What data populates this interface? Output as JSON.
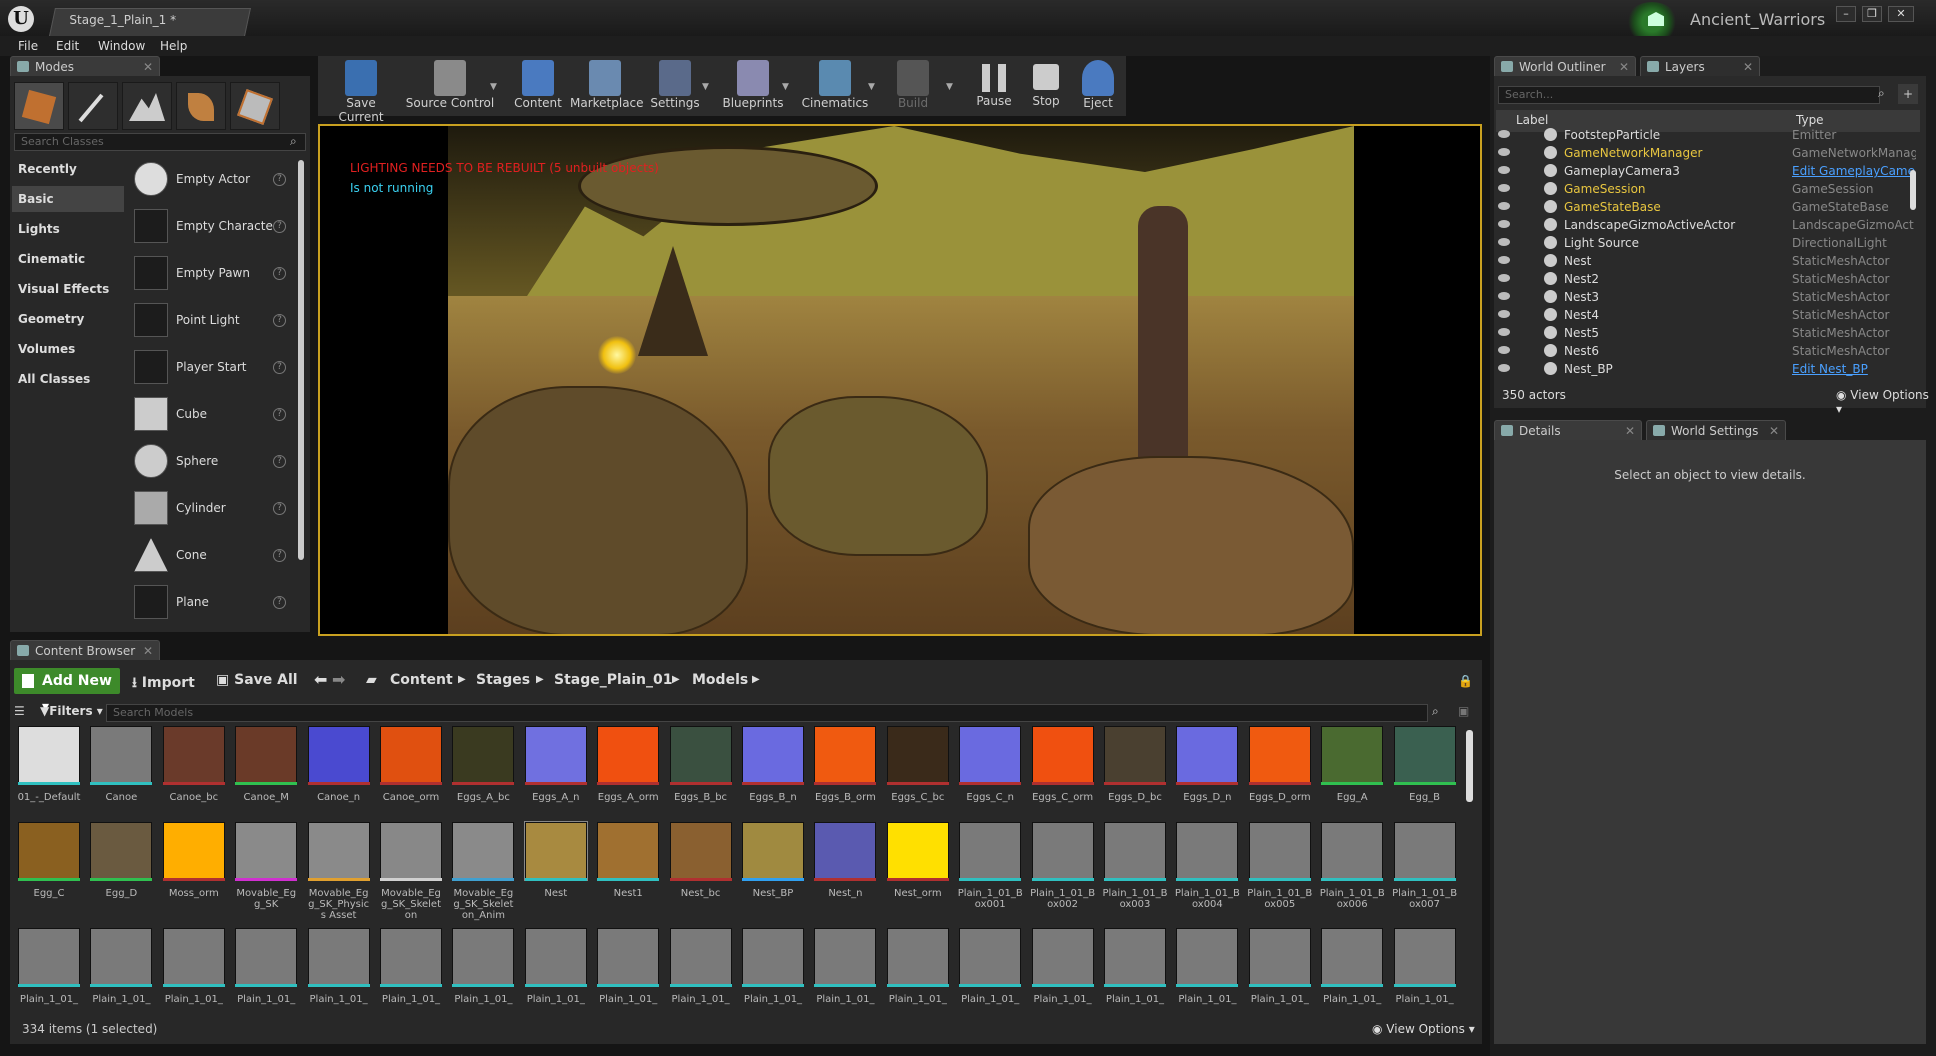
{
  "window": {
    "doc_tab": "Stage_1_Plain_1",
    "doc_tab_dirty": "*",
    "project": "Ancient_Warriors"
  },
  "menu": [
    "File",
    "Edit",
    "Window",
    "Help"
  ],
  "modes": {
    "tab": "Modes",
    "search_placeholder": "Search Classes",
    "categories": [
      "Recently Placed",
      "Basic",
      "Lights",
      "Cinematic",
      "Visual Effects",
      "Geometry",
      "Volumes",
      "All Classes"
    ],
    "selected_category": "Basic",
    "items": [
      "Empty Actor",
      "Empty Characte",
      "Empty Pawn",
      "Point Light",
      "Player Start",
      "Cube",
      "Sphere",
      "Cylinder",
      "Cone",
      "Plane"
    ]
  },
  "toolbar": [
    "Save Current",
    "Source Control",
    "Content",
    "Marketplace",
    "Settings",
    "Blueprints",
    "Cinematics",
    "Build",
    "Pause",
    "Stop",
    "Eject"
  ],
  "viewport": {
    "warning": "LIGHTING NEEDS TO BE REBUILT (5 unbuilt objects)",
    "status": "Is not running"
  },
  "outliner": {
    "tabs": [
      "World Outliner",
      "Layers"
    ],
    "search_placeholder": "Search...",
    "col_label": "Label",
    "col_type": "Type",
    "rows": [
      {
        "label": "FootstepParticle",
        "type": "Emitter",
        "link": false
      },
      {
        "label": "GameNetworkManager",
        "type": "GameNetworkManag",
        "link": false,
        "hl": true
      },
      {
        "label": "GameplayCamera3",
        "type": "Edit GameplayCame",
        "link": true
      },
      {
        "label": "GameSession",
        "type": "GameSession",
        "link": false,
        "hl": true
      },
      {
        "label": "GameStateBase",
        "type": "GameStateBase",
        "link": false,
        "hl": true
      },
      {
        "label": "LandscapeGizmoActiveActor",
        "type": "LandscapeGizmoAct",
        "link": false
      },
      {
        "label": "Light Source",
        "type": "DirectionalLight",
        "link": false
      },
      {
        "label": "Nest",
        "type": "StaticMeshActor",
        "link": false
      },
      {
        "label": "Nest2",
        "type": "StaticMeshActor",
        "link": false
      },
      {
        "label": "Nest3",
        "type": "StaticMeshActor",
        "link": false
      },
      {
        "label": "Nest4",
        "type": "StaticMeshActor",
        "link": false
      },
      {
        "label": "Nest5",
        "type": "StaticMeshActor",
        "link": false
      },
      {
        "label": "Nest6",
        "type": "StaticMeshActor",
        "link": false
      },
      {
        "label": "Nest_BP",
        "type": "Edit Nest_BP",
        "link": true
      }
    ],
    "count": "350 actors",
    "view_options": "View Options"
  },
  "details": {
    "tabs": [
      "Details",
      "World Settings"
    ],
    "empty": "Select an object to view details."
  },
  "content_browser": {
    "tab": "Content Browser",
    "add_new": "Add New",
    "import": "Import",
    "save_all": "Save All",
    "path": [
      "Content",
      "Stages",
      "Stage_Plain_01",
      "Models"
    ],
    "filters": "Filters",
    "search_placeholder": "Search Models",
    "status": "334 items (1 selected)",
    "view_options": "View Options",
    "assets_row1": [
      "01_-_Default",
      "Canoe",
      "Canoe_bc",
      "Canoe_M",
      "Canoe_n",
      "Canoe_orm",
      "Eggs_A_bc",
      "Eggs_A_n",
      "Eggs_A_orm",
      "Eggs_B_bc",
      "Eggs_B_n",
      "Eggs_B_orm",
      "Eggs_C_bc",
      "Eggs_C_n",
      "Eggs_C_orm",
      "Eggs_D_bc",
      "Eggs_D_n",
      "Eggs_D_orm",
      "Egg_A",
      "Egg_B"
    ],
    "assets_row2": [
      "Egg_C",
      "Egg_D",
      "Moss_orm",
      "Movable_Egg_SK",
      "Movable_Egg_SK_Physics Asset",
      "Movable_Egg_SK_Skeleton",
      "Movable_Egg_SK_Skeleton_Anim",
      "Nest",
      "Nest1",
      "Nest_bc",
      "Nest_BP",
      "Nest_n",
      "Nest_orm",
      "Plain_1_01_Box001",
      "Plain_1_01_Box002",
      "Plain_1_01_Box003",
      "Plain_1_01_Box004",
      "Plain_1_01_Box005",
      "Plain_1_01_Box006",
      "Plain_1_01_Box007"
    ],
    "assets_row3": [
      "Plain_1_01_",
      "Plain_1_01_",
      "Plain_1_01_",
      "Plain_1_01_",
      "Plain_1_01_",
      "Plain_1_01_",
      "Plain_1_01_",
      "Plain_1_01_",
      "Plain_1_01_",
      "Plain_1_01_",
      "Plain_1_01_",
      "Plain_1_01_",
      "Plain_1_01_",
      "Plain_1_01_",
      "Plain_1_01_",
      "Plain_1_01_",
      "Plain_1_01_",
      "Plain_1_01_",
      "Plain_1_01_",
      "Plain_1_01_"
    ],
    "selected_asset": "Nest"
  },
  "colors": {
    "accent_green": "#3d8a2a",
    "viewport_border": "#c8a020",
    "link": "#4aa0ff"
  }
}
